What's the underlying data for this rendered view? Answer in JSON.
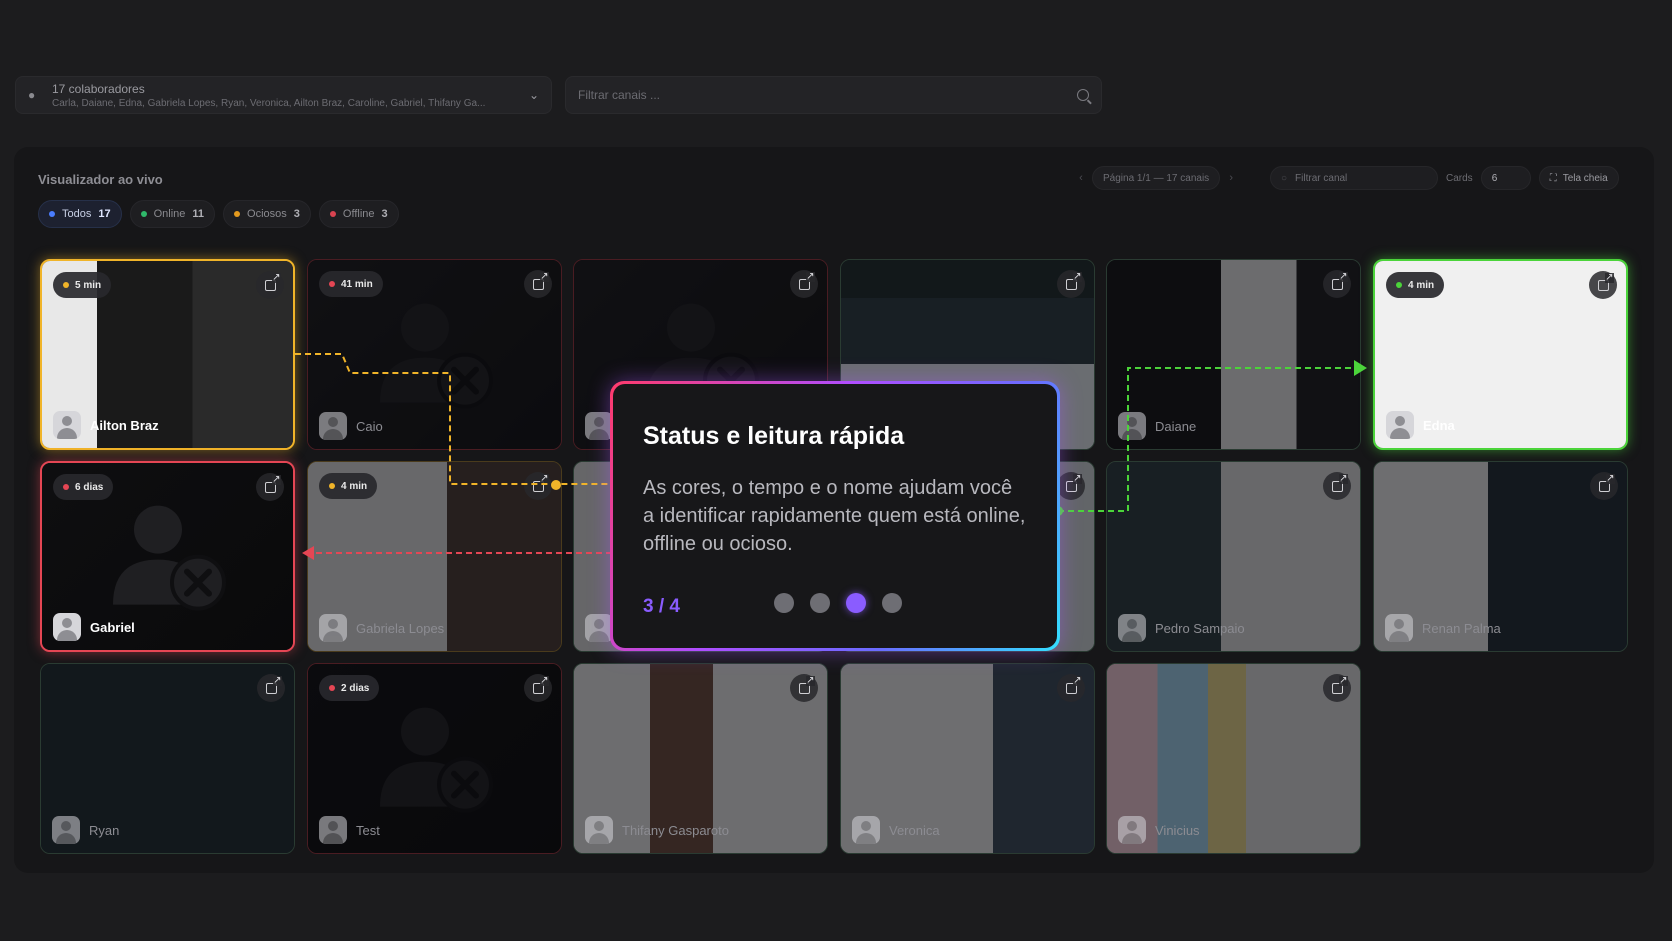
{
  "collaborators": {
    "title": "17 colaboradores",
    "names": "Carla, Daiane, Edna, Gabriela Lopes, Ryan, Veronica, Ailton Braz, Caroline, Gabriel, Thifany Ga..."
  },
  "channel_search": {
    "placeholder": "Filtrar canais ..."
  },
  "panel": {
    "title": "Visualizador ao vivo",
    "page_info": "Página 1/1 — 17 canais",
    "channel_filter_placeholder": "Filtrar canal",
    "cards_label": "Cards",
    "cards_value": "6",
    "fullscreen_label": "Tela cheia"
  },
  "filters": [
    {
      "label": "Todos",
      "count": "17",
      "color": "#4a7dff"
    },
    {
      "label": "Online",
      "count": "11",
      "color": "#2fb86a"
    },
    {
      "label": "Ociosos",
      "count": "3",
      "color": "#e39a1e"
    },
    {
      "label": "Offline",
      "count": "3",
      "color": "#d84350"
    }
  ],
  "cards": [
    {
      "name": "Ailton Braz",
      "badge": "5 min",
      "status": "idle"
    },
    {
      "name": "Caio",
      "badge": "41 min",
      "status": "offline"
    },
    {
      "name": "",
      "badge": "",
      "status": "offline"
    },
    {
      "name": "",
      "badge": "",
      "status": "online"
    },
    {
      "name": "Daiane",
      "badge": "",
      "status": "online"
    },
    {
      "name": "Edna",
      "badge": "4 min",
      "status": "online"
    },
    {
      "name": "Gabriel",
      "badge": "6 dias",
      "status": "offline"
    },
    {
      "name": "Gabriela Lopes",
      "badge": "4 min",
      "status": "idle"
    },
    {
      "name": "",
      "badge": "",
      "status": "online"
    },
    {
      "name": "",
      "badge": "",
      "status": "online"
    },
    {
      "name": "Pedro Sampaio",
      "badge": "",
      "status": "online"
    },
    {
      "name": "Renan Palma",
      "badge": "",
      "status": "online"
    },
    {
      "name": "Ryan",
      "badge": "",
      "status": "online"
    },
    {
      "name": "Test",
      "badge": "2 dias",
      "status": "offline"
    },
    {
      "name": "Thifany Gasparoto",
      "badge": "",
      "status": "online"
    },
    {
      "name": "Veronica",
      "badge": "",
      "status": "online"
    },
    {
      "name": "Vinicius",
      "badge": "",
      "status": "online"
    }
  ],
  "tour": {
    "title": "Status e leitura rápida",
    "text": "As cores, o tempo e o nome ajudam você a identificar rapidamente quem está online, offline ou ocioso.",
    "step": "3 / 4",
    "total_steps": 4,
    "current_step": 3
  },
  "colors": {
    "online": "#4bd43a",
    "idle": "#f0b429",
    "offline": "#e54654",
    "accent": "#8a5cff"
  }
}
